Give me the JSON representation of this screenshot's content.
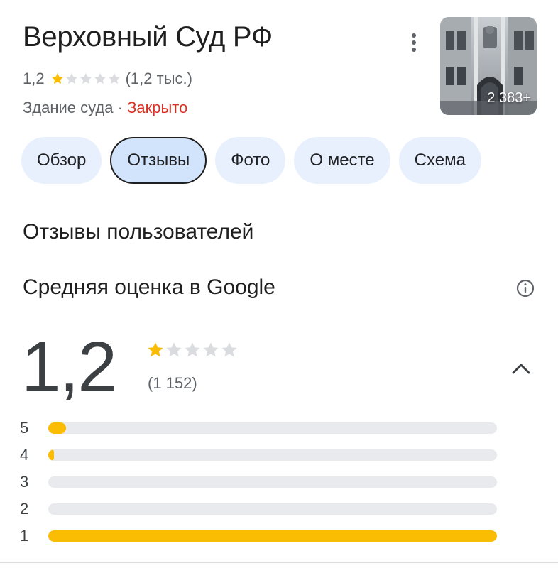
{
  "place": {
    "name": "Верховный Суд РФ",
    "rating": "1,2",
    "rating_count_short": "(1,2 тыс.)",
    "category": "Здание суда",
    "separator": "·",
    "status": "Закрыто",
    "photo_count": "2 383+"
  },
  "tabs": [
    {
      "label": "Обзор",
      "active": false
    },
    {
      "label": "Отзывы",
      "active": true
    },
    {
      "label": "Фото",
      "active": false
    },
    {
      "label": "О месте",
      "active": false
    },
    {
      "label": "Схема",
      "active": false
    }
  ],
  "reviews": {
    "section_title": "Отзывы пользователей",
    "average_title": "Средняя оценка в Google",
    "score": "1,2",
    "stars_filled": 1,
    "total_reviews": "(1 152)",
    "distribution": [
      {
        "label": "5",
        "fraction": 0.04
      },
      {
        "label": "4",
        "fraction": 0.01
      },
      {
        "label": "3",
        "fraction": 0.0
      },
      {
        "label": "2",
        "fraction": 0.0
      },
      {
        "label": "1",
        "fraction": 1.0
      }
    ]
  },
  "colors": {
    "star_filled": "#fbbc04",
    "star_empty": "#dadce0",
    "status_closed": "#d93025",
    "tab_bg": "#e8f0fe",
    "tab_active_bg": "#d2e3fc"
  },
  "icons": {
    "menu": "more-vert-icon",
    "info": "info-icon",
    "collapse": "chevron-up-icon",
    "star": "star-icon"
  }
}
